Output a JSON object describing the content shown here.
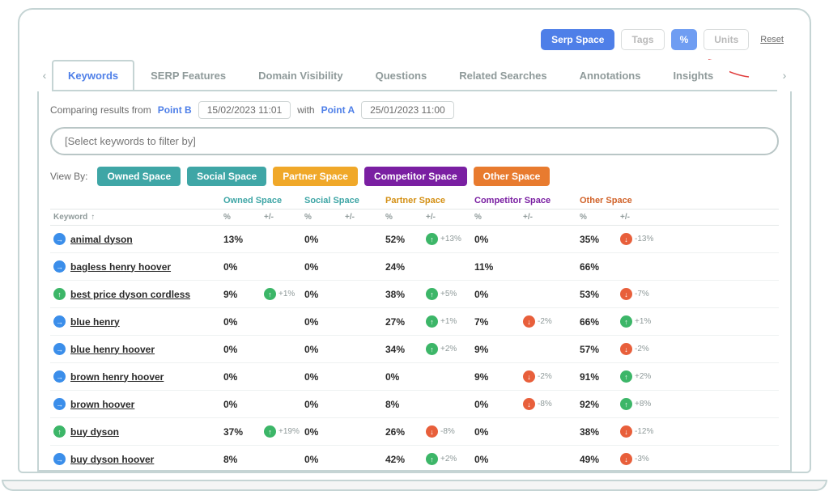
{
  "top_controls": {
    "serp_space": "Serp Space",
    "tags": "Tags",
    "percent": "%",
    "units": "Units",
    "reset": "Reset"
  },
  "tabs": [
    "Keywords",
    "SERP Features",
    "Domain Visibility",
    "Questions",
    "Related Searches",
    "Annotations",
    "Insights"
  ],
  "compare": {
    "prefix": "Comparing results from",
    "point_b": "Point B",
    "date_b": "15/02/2023 11:01",
    "with": "with",
    "point_a": "Point A",
    "date_a": "25/01/2023 11:00"
  },
  "filter_placeholder": "[Select keywords to filter by]",
  "viewby": {
    "label": "View By:",
    "owned": "Owned Space",
    "social": "Social Space",
    "partner": "Partner Space",
    "competitor": "Competitor Space",
    "other": "Other Space"
  },
  "col_headers": {
    "keyword": "Keyword",
    "owned": "Owned Space",
    "social": "Social Space",
    "partner": "Partner Space",
    "competitor": "Competitor Space",
    "other": "Other Space",
    "pct": "%",
    "delta": "+/-"
  },
  "rows": [
    {
      "icon": "blue",
      "kw": "animal dyson",
      "owned": {
        "v": "13%",
        "d": null
      },
      "social": {
        "v": "0%",
        "d": null
      },
      "partner": {
        "v": "52%",
        "d": "+13%",
        "dir": "up"
      },
      "comp": {
        "v": "0%",
        "d": null
      },
      "other": {
        "v": "35%",
        "d": "-13%",
        "dir": "down"
      }
    },
    {
      "icon": "blue",
      "kw": "bagless henry hoover",
      "owned": {
        "v": "0%",
        "d": null
      },
      "social": {
        "v": "0%",
        "d": null
      },
      "partner": {
        "v": "24%",
        "d": null
      },
      "comp": {
        "v": "11%",
        "d": null
      },
      "other": {
        "v": "66%",
        "d": null
      }
    },
    {
      "icon": "green",
      "kw": "best price dyson cordless",
      "owned": {
        "v": "9%",
        "d": "+1%",
        "dir": "up"
      },
      "social": {
        "v": "0%",
        "d": null
      },
      "partner": {
        "v": "38%",
        "d": "+5%",
        "dir": "up"
      },
      "comp": {
        "v": "0%",
        "d": null
      },
      "other": {
        "v": "53%",
        "d": "-7%",
        "dir": "down"
      }
    },
    {
      "icon": "blue",
      "kw": "blue henry",
      "owned": {
        "v": "0%",
        "d": null
      },
      "social": {
        "v": "0%",
        "d": null
      },
      "partner": {
        "v": "27%",
        "d": "+1%",
        "dir": "up"
      },
      "comp": {
        "v": "7%",
        "d": "-2%",
        "dir": "down"
      },
      "other": {
        "v": "66%",
        "d": "+1%",
        "dir": "up"
      }
    },
    {
      "icon": "blue",
      "kw": "blue henry hoover",
      "owned": {
        "v": "0%",
        "d": null
      },
      "social": {
        "v": "0%",
        "d": null
      },
      "partner": {
        "v": "34%",
        "d": "+2%",
        "dir": "up"
      },
      "comp": {
        "v": "9%",
        "d": null
      },
      "other": {
        "v": "57%",
        "d": "-2%",
        "dir": "down"
      }
    },
    {
      "icon": "blue",
      "kw": "brown henry hoover",
      "owned": {
        "v": "0%",
        "d": null
      },
      "social": {
        "v": "0%",
        "d": null
      },
      "partner": {
        "v": "0%",
        "d": null
      },
      "comp": {
        "v": "9%",
        "d": "-2%",
        "dir": "down"
      },
      "other": {
        "v": "91%",
        "d": "+2%",
        "dir": "up"
      }
    },
    {
      "icon": "blue",
      "kw": "brown hoover",
      "owned": {
        "v": "0%",
        "d": null
      },
      "social": {
        "v": "0%",
        "d": null
      },
      "partner": {
        "v": "8%",
        "d": null
      },
      "comp": {
        "v": "0%",
        "d": "-8%",
        "dir": "down"
      },
      "other": {
        "v": "92%",
        "d": "+8%",
        "dir": "up"
      }
    },
    {
      "icon": "green",
      "kw": "buy dyson",
      "owned": {
        "v": "37%",
        "d": "+19%",
        "dir": "up"
      },
      "social": {
        "v": "0%",
        "d": null
      },
      "partner": {
        "v": "26%",
        "d": "-8%",
        "dir": "down"
      },
      "comp": {
        "v": "0%",
        "d": null
      },
      "other": {
        "v": "38%",
        "d": "-12%",
        "dir": "down"
      }
    },
    {
      "icon": "blue",
      "kw": "buy dyson hoover",
      "owned": {
        "v": "8%",
        "d": null
      },
      "social": {
        "v": "0%",
        "d": null
      },
      "partner": {
        "v": "42%",
        "d": "+2%",
        "dir": "up"
      },
      "comp": {
        "v": "0%",
        "d": null
      },
      "other": {
        "v": "49%",
        "d": "-3%",
        "dir": "down"
      }
    }
  ]
}
